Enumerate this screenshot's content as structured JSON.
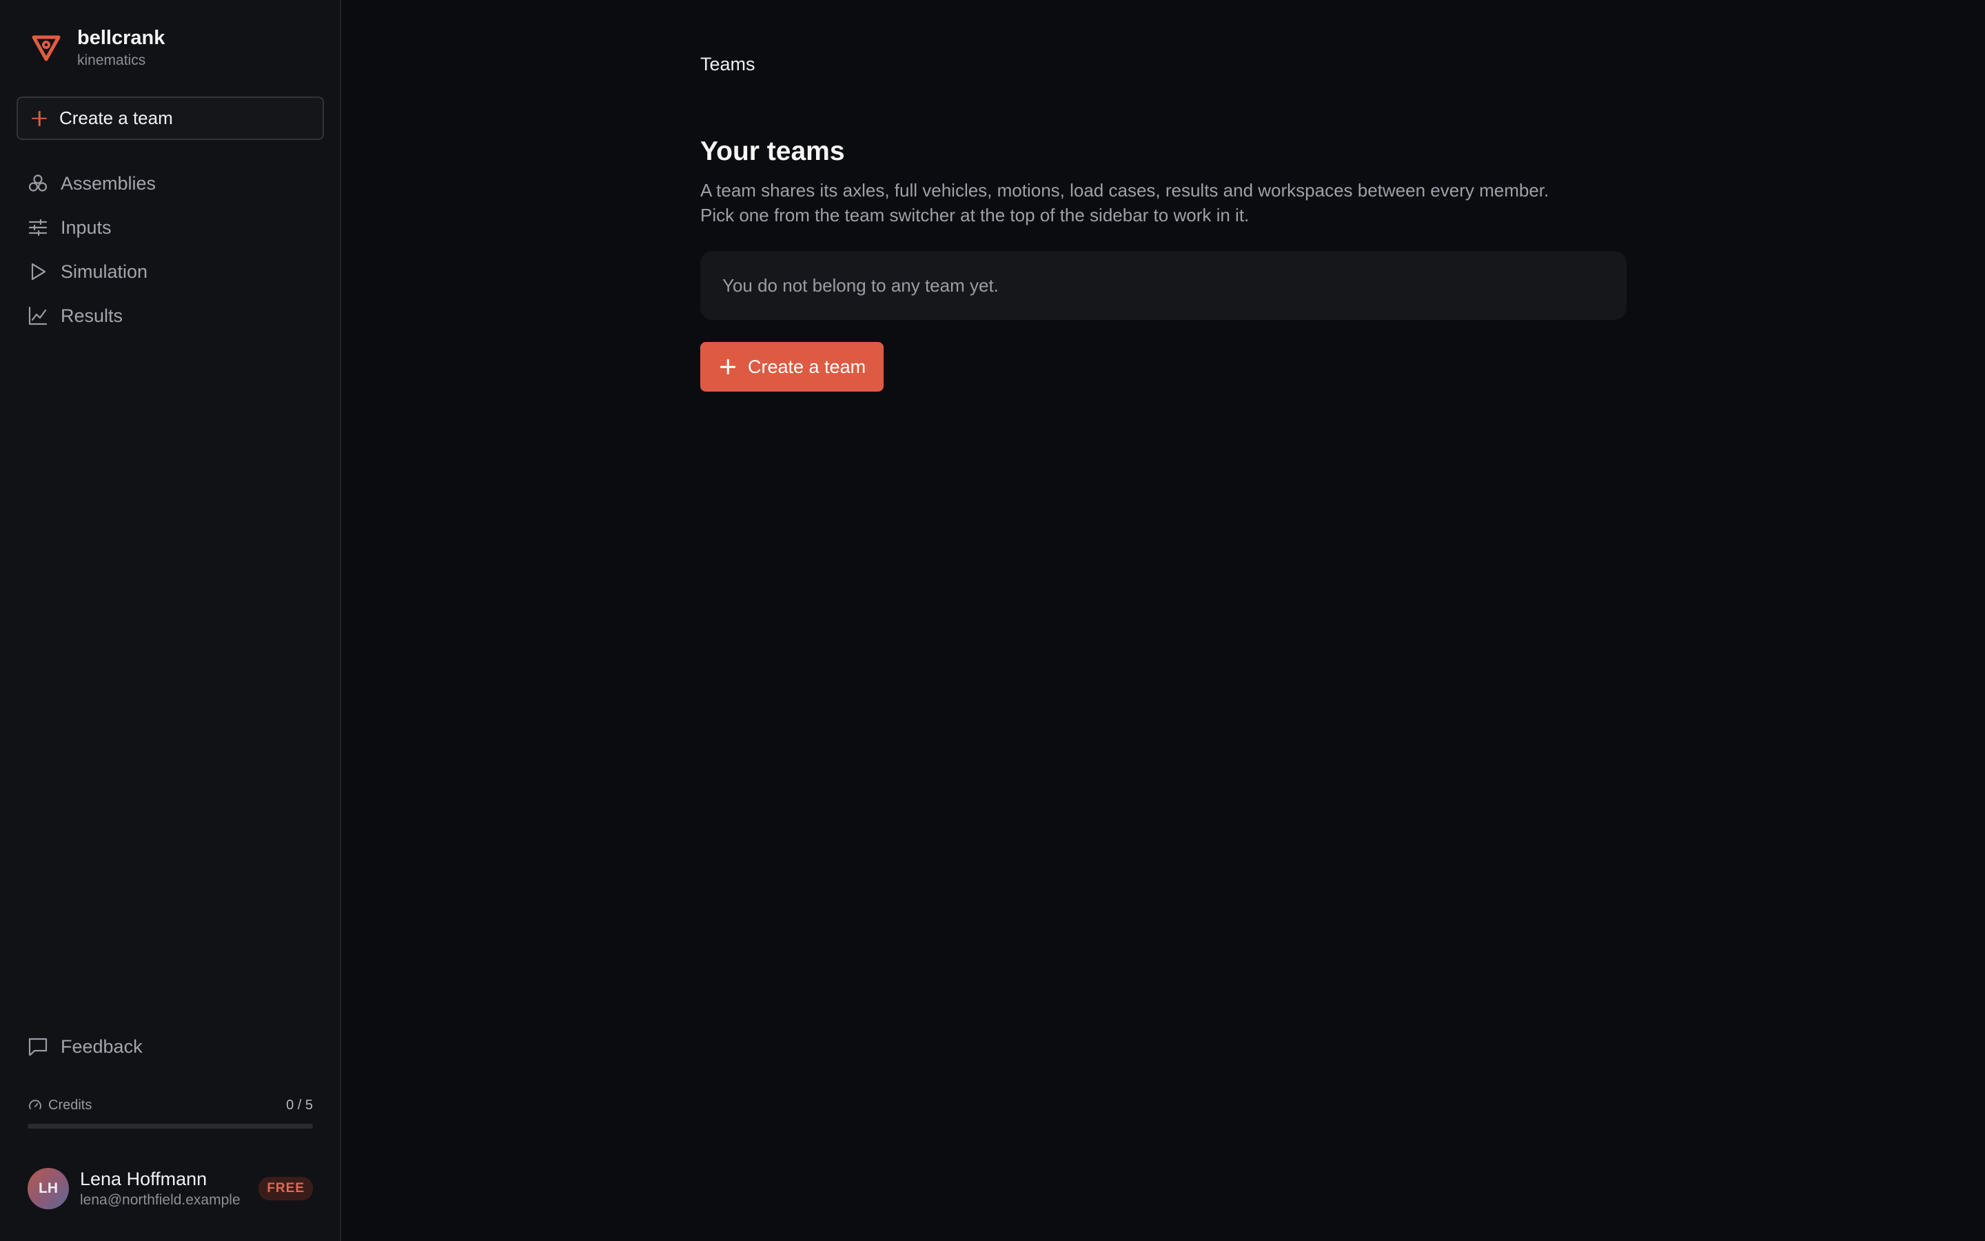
{
  "brand": {
    "name": "bellcrank",
    "subtitle": "kinematics",
    "accent_color": "#e05c43"
  },
  "sidebar": {
    "create_team_label": "Create a team",
    "items": [
      {
        "label": "Assemblies",
        "icon": "assemblies-icon"
      },
      {
        "label": "Inputs",
        "icon": "sliders-icon"
      },
      {
        "label": "Simulation",
        "icon": "play-icon"
      },
      {
        "label": "Results",
        "icon": "chart-line-icon"
      }
    ],
    "feedback_label": "Feedback",
    "credits": {
      "label": "Credits",
      "value_text": "0 / 5",
      "used": 0,
      "total": 5
    },
    "user": {
      "initials": "LH",
      "name": "Lena Hoffmann",
      "email": "lena@northfield.example",
      "plan_badge": "FREE"
    }
  },
  "main": {
    "breadcrumb": "Teams",
    "title": "Your teams",
    "description_line1": "A team shares its axles, full vehicles, motions, load cases, results and workspaces between every member.",
    "description_line2": "Pick one from the team switcher at the top of the sidebar to work in it.",
    "empty_state": "You do not belong to any team yet.",
    "create_button_label": "Create a team"
  }
}
